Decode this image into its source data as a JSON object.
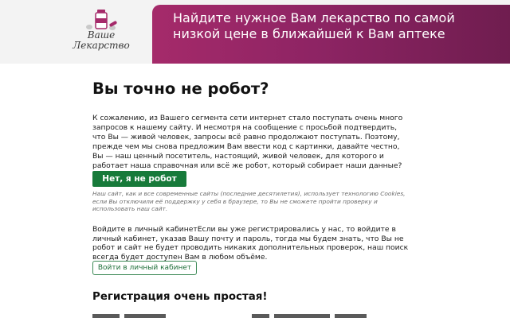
{
  "logo": {
    "line1": "Ваше",
    "line2": "Лекарство",
    "icon": "bottle-and-tablets-icon"
  },
  "banner": {
    "text": "Найдите нужное Вам лекарство по самой низкой цене в ближайшей к Вам аптеке"
  },
  "main": {
    "title": "Вы точно не робот?",
    "intro": "К сожалению, из Вашего сегмента сети интернет стало поступать очень много запросов к нашему сайту. И несмотря на сообщение с просьбой подтвердить, что Вы — живой человек, запросы всё равно продолжают поступать. Поэтому, прежде чем мы снова предложим Вам ввести код с картинки, давайте честно, Вы — наш ценный посетитель, настоящий, живой человек, для которого и работает наша справочная или всё же робот, который собирает наши данные?",
    "not_robot_button": "Нет, я не робот",
    "cookie_note": "Наш сайт, как и все современные сайты (последние десятилетия), использует технологию Cookies, если Вы отключили её поддержку у себя в браузере, то Вы не сможете пройти проверку и использовать наш сайт.",
    "login_text": "Войдите в личный кабинетЕсли вы уже регистрировались у нас, то войдите в личный кабинет, указав Вашу почту и пароль, тогда мы будем знать, что Вы не робот и сайт не будет проводить никаких дополнительных проверок, наш поиск всегда будет доступен Вам в любом объёме.",
    "cabinet_button": "Войти в личный кабинет",
    "registration_heading": "Регистрация очень простая!"
  },
  "colors": {
    "banner": "#8e2464",
    "primary_button": "#177a3a",
    "outline_button": "#1f6f3a"
  }
}
